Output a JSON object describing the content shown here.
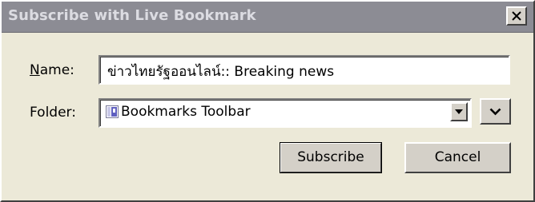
{
  "dialog": {
    "title": "Subscribe with Live Bookmark",
    "close_icon": "close-icon"
  },
  "form": {
    "name_label_accel": "N",
    "name_label_rest": "ame:",
    "name_value": "ข่าวไทยรัฐออนไลน์:: Breaking news",
    "folder_label": "Folder:",
    "folder_value": "Bookmarks Toolbar",
    "folder_icon": "bookmarks-toolbar-icon"
  },
  "buttons": {
    "subscribe_label": "Subscribe",
    "cancel_label": "Cancel"
  },
  "colors": {
    "titlebar_inactive": "#8c8c94",
    "title_text": "#dcdce2",
    "face": "#d4d0c8",
    "background": "#ece9d8"
  }
}
